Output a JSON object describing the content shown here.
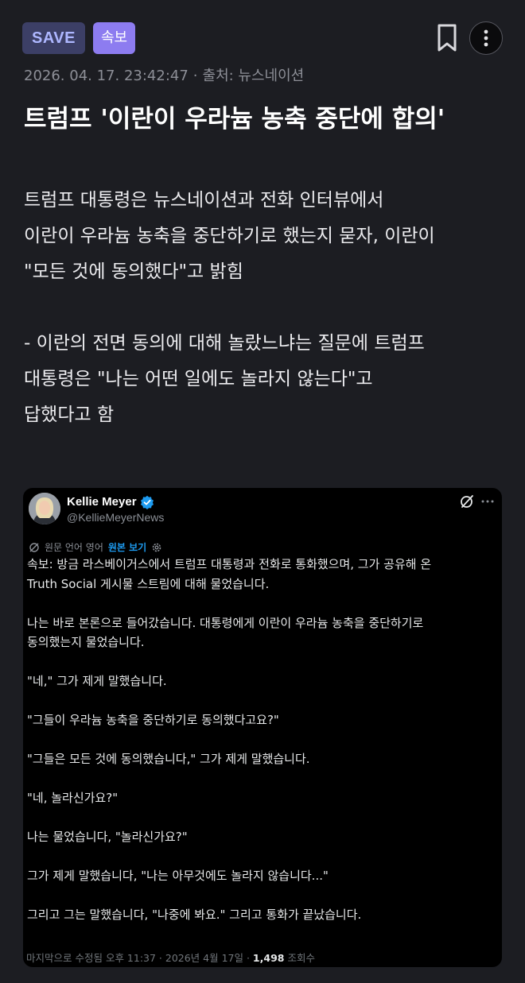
{
  "header": {
    "save_label": "SAVE",
    "badge_label": "속보",
    "icons": [
      "bookmark-icon",
      "more-vertical-icon"
    ]
  },
  "article": {
    "datetime": "2026. 04. 17. 23:42:47",
    "separator": "·",
    "source": "출처: 뉴스네이션",
    "title": "트럼프 '이란이 우라늄 농축 중단에 합의'",
    "paragraph1": [
      "트럼프 대통령은 뉴스네이션과 전화 인터뷰에서",
      "이란이 우라늄 농축을 중단하기로 했는지 묻자, 이란이",
      "\"모든 것에 동의했다\"고 밝힘"
    ],
    "paragraph2": [
      "- 이란의 전면 동의에 대해 놀랐느냐는 질문에 트럼프",
      "대통령은 \"나는 어떤 일에도 놀라지 않는다\"고",
      "답했다고 함"
    ]
  },
  "tweet": {
    "author_name": "Kellie Meyer",
    "author_handle": "@KellieMeyerNews",
    "translation_note": "원문 언어 영어",
    "view_original": "원본 보기",
    "lines": [
      "속보: 방금 라스베이거스에서 트럼프 대통령과 전화로 통화했으며, 그가 공유해 온",
      "Truth Social 게시물 스트림에 대해 물었습니다.",
      "",
      "나는 바로 본론으로 들어갔습니다. 대통령에게 이란이 우라늄 농축을 중단하기로",
      "동의했는지 물었습니다.",
      "",
      "\"네,\" 그가 제게 말했습니다.",
      "",
      "\"그들이 우라늄 농축을 중단하기로 동의했다고요?\"",
      "",
      "\"그들은 모든 것에 동의했습니다,\" 그가 제게 말했습니다.",
      "",
      "\"네, 놀라신가요?\"",
      "",
      "나는 물었습니다, \"놀라신가요?\"",
      "",
      "그가 제게 말했습니다, \"나는 아무것에도 놀라지 않습니다...\"",
      "",
      "그리고 그는 말했습니다, \"나중에 봐요.\" 그리고 통화가 끝났습니다."
    ],
    "footer_edited": "마지막으로 수정됨 오후 11:37 · 2026년 4월 17일 ·",
    "footer_views": "1,498",
    "footer_views_label": "조회수",
    "colors": {
      "link": "#1d9bf0",
      "verified": "#1d9bf0"
    }
  },
  "colors": {
    "background": "#1c1d22",
    "save_badge_bg": "#3c3f66",
    "breaking_badge_bg": "#8d7cf0"
  }
}
